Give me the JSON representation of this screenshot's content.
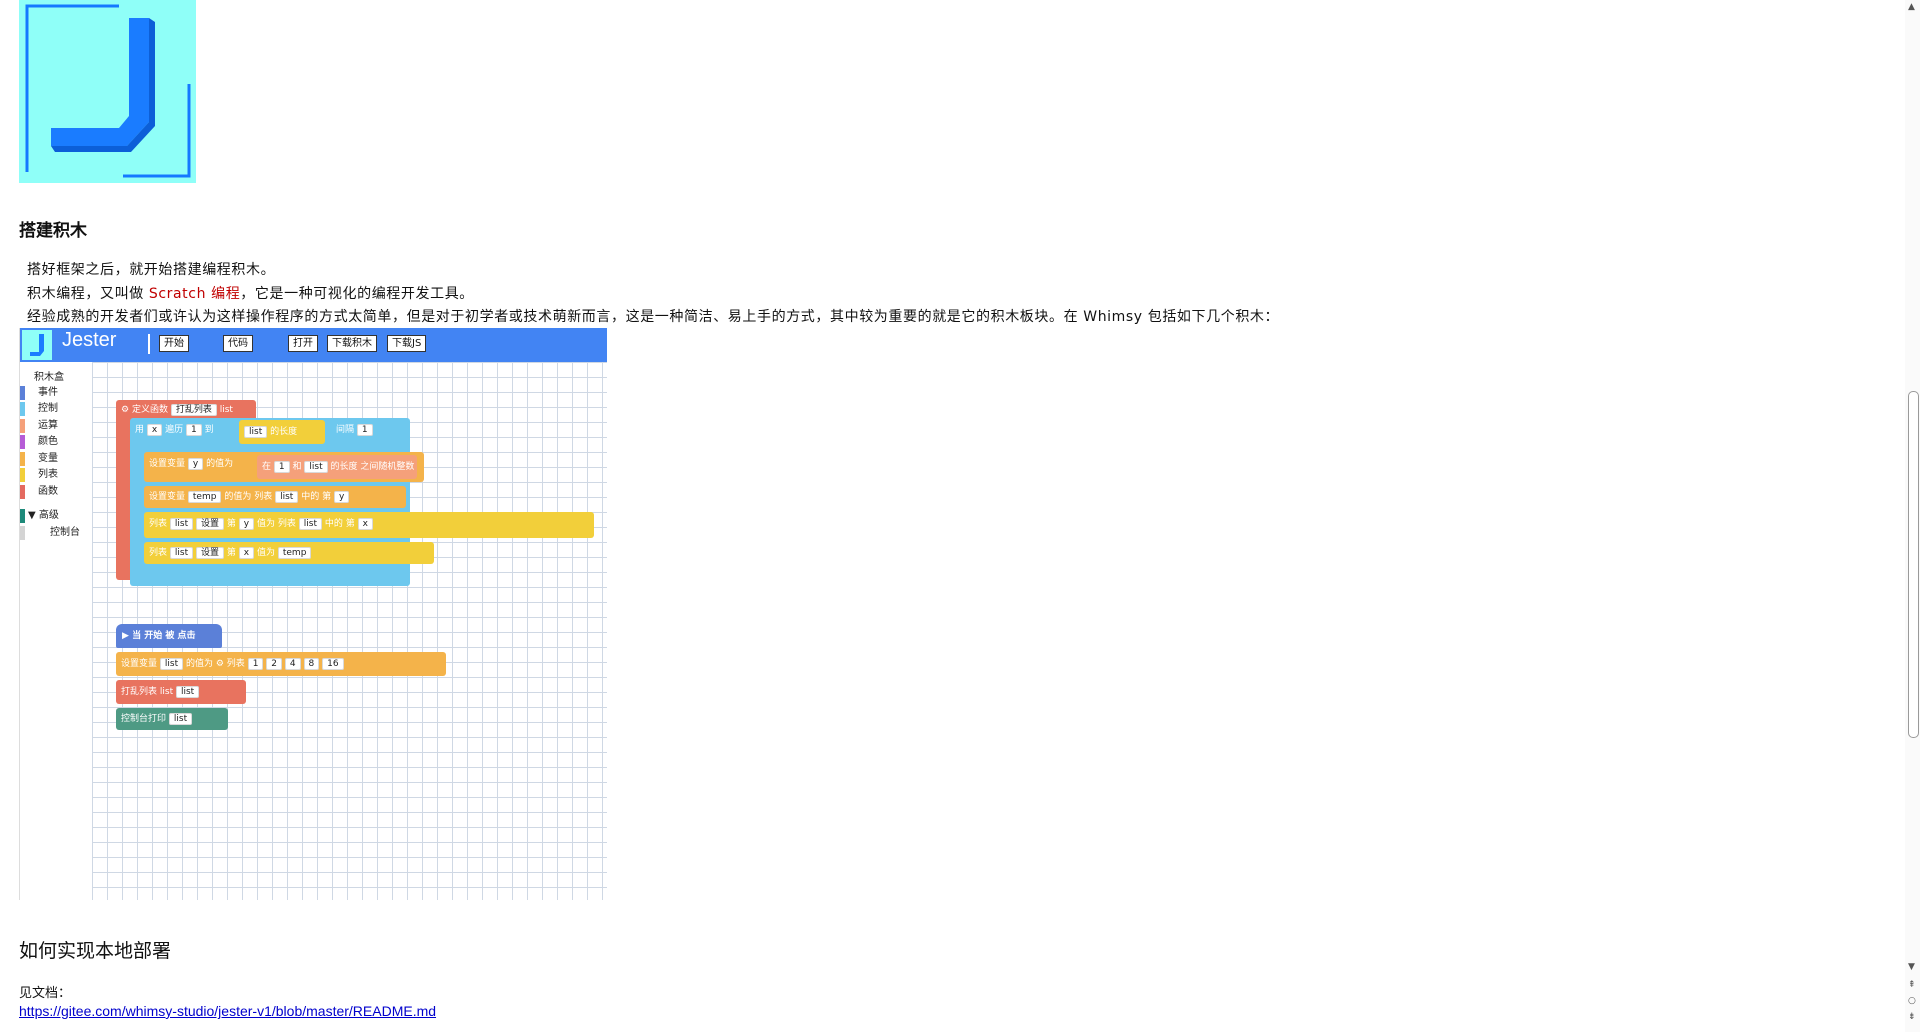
{
  "section_heading": "搭建积木",
  "paragraphs": {
    "p1": "搭好框架之后，就开始搭建编程积木。",
    "p2_before": "积木编程，又叫做 ",
    "p2_red": "Scratch 编程",
    "p2_after": "，它是一种可视化的编程开发工具。",
    "p3": "经验成熟的开发者们或许认为这样操作程序的方式太简单，但是对于初学者或技术萌新而言，这是一种简洁、易上手的方式，其中较为重要的就是它的积木板块。在 Whimsy 包括如下几个积木："
  },
  "jester_app": {
    "logo_letter": "J",
    "brand": "Jester",
    "toolbar_buttons": [
      "开始",
      "代码",
      "打开",
      "下载积木",
      "下载JS"
    ],
    "toolbox_title": "积木盒",
    "toolbox_items": [
      {
        "label": "事件",
        "color": "#5b80d8"
      },
      {
        "label": "控制",
        "color": "#6dc8ee"
      },
      {
        "label": "运算",
        "color": "#f5a07a"
      },
      {
        "label": "颜色",
        "color": "#b65cd6"
      },
      {
        "label": "变量",
        "color": "#f4b34a"
      },
      {
        "label": "列表",
        "color": "#f2cf3a"
      },
      {
        "label": "函数",
        "color": "#e46a60"
      }
    ],
    "advanced_label": "▼ 高级",
    "console_label": "控制台",
    "blocks": {
      "define": "定义函数",
      "shuffle_fn": "打乱列表",
      "param": "list",
      "for_use": "用",
      "for_var": "x",
      "for_iterate": "遍历",
      "for_from": "1",
      "for_to": "到",
      "list": "list",
      "length": "的长度",
      "step": "间隔",
      "step_val": "1",
      "set_var": "设置变量",
      "var_y": "y",
      "value_of": "的值为",
      "random_in": "在",
      "random_and": "和",
      "random_between": "之间随机整数",
      "var_temp": "temp",
      "list_word": "列表",
      "in_list": "中的",
      "index_word": "第",
      "set_word": "设置",
      "value_eq": "值为",
      "hat": "当 开始 被 点击",
      "var_list": "list",
      "list_items": [
        "1",
        "2",
        "4",
        "8",
        "16"
      ],
      "call_shuffle": "打乱列表",
      "console_print": "控制台打印"
    }
  },
  "deploy_heading": "如何实现本地部署",
  "see_docs": "见文档：",
  "doc_link": "https://gitee.com/whimsy-studio/jester-v1/blob/master/README.md"
}
